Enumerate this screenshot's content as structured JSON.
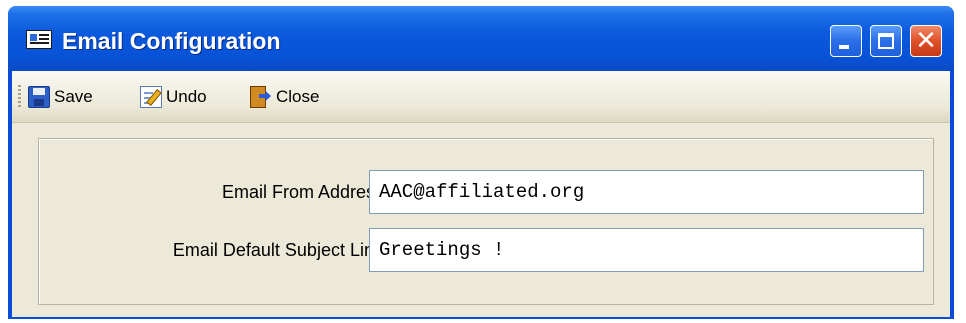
{
  "window": {
    "title": "Email Configuration",
    "title_icon": "form-icon"
  },
  "title_buttons": {
    "minimize_icon": "minimize-icon",
    "maximize_icon": "maximize-icon",
    "close_icon": "close-icon",
    "close_glyph": "✕"
  },
  "toolbar": {
    "save_label": "Save",
    "save_icon": "floppy-disk-icon",
    "undo_label": "Undo",
    "undo_icon": "edit-icon",
    "close_label": "Close",
    "close_icon": "exit-door-icon"
  },
  "form": {
    "from_address": {
      "label": "Email From Address:",
      "value": "AAC@affiliated.org"
    },
    "subject_line": {
      "label": "Email Default Subject Line:",
      "value": "Greetings !"
    }
  },
  "colors": {
    "titlebar": "#0a58dc",
    "client_background": "#ece9d8",
    "input_border": "#7f9db9",
    "close_button": "#e0502a"
  }
}
